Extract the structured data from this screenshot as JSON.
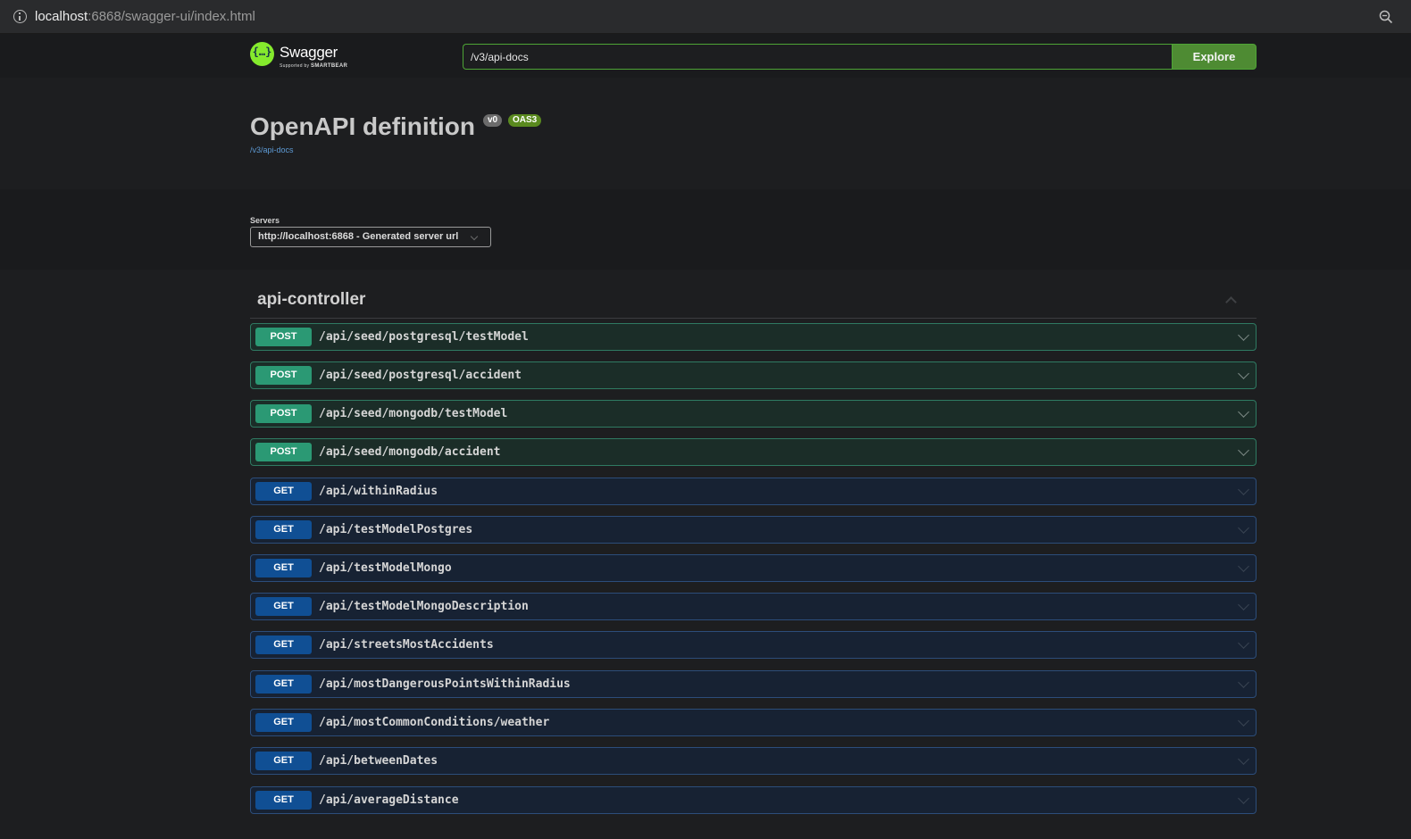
{
  "browser": {
    "url_host": "localhost",
    "url_rest": ":6868/swagger-ui/index.html",
    "info_icon": "info-icon",
    "zoom_icon": "zoom-icon"
  },
  "topbar": {
    "logo_word": "Swagger",
    "logo_sub_prefix": "Supported by",
    "logo_sub_brand": "SMARTBEAR",
    "logo_glyph": "{…}",
    "search_value": "/v3/api-docs",
    "explore_label": "Explore",
    "accent_color": "#85ea2d"
  },
  "info": {
    "title": "OpenAPI definition",
    "version_badge": "v0",
    "oas_badge": "OAS3",
    "docs_link": "/v3/api-docs"
  },
  "servers": {
    "label": "Servers",
    "selected": "http://localhost:6868 - Generated server url"
  },
  "tag": {
    "name": "api-controller",
    "operations": [
      {
        "method": "POST",
        "path": "/api/seed/postgresql/testModel"
      },
      {
        "method": "POST",
        "path": "/api/seed/postgresql/accident"
      },
      {
        "method": "POST",
        "path": "/api/seed/mongodb/testModel"
      },
      {
        "method": "POST",
        "path": "/api/seed/mongodb/accident"
      },
      {
        "method": "GET",
        "path": "/api/withinRadius"
      },
      {
        "method": "GET",
        "path": "/api/testModelPostgres"
      },
      {
        "method": "GET",
        "path": "/api/testModelMongo"
      },
      {
        "method": "GET",
        "path": "/api/testModelMongoDescription"
      },
      {
        "method": "GET",
        "path": "/api/streetsMostAccidents"
      },
      {
        "method": "GET",
        "path": "/api/mostDangerousPointsWithinRadius"
      },
      {
        "method": "GET",
        "path": "/api/mostCommonConditions/weather"
      },
      {
        "method": "GET",
        "path": "/api/betweenDates"
      },
      {
        "method": "GET",
        "path": "/api/averageDistance"
      }
    ]
  },
  "colors": {
    "post": "#2b9974",
    "get": "#104f94"
  }
}
